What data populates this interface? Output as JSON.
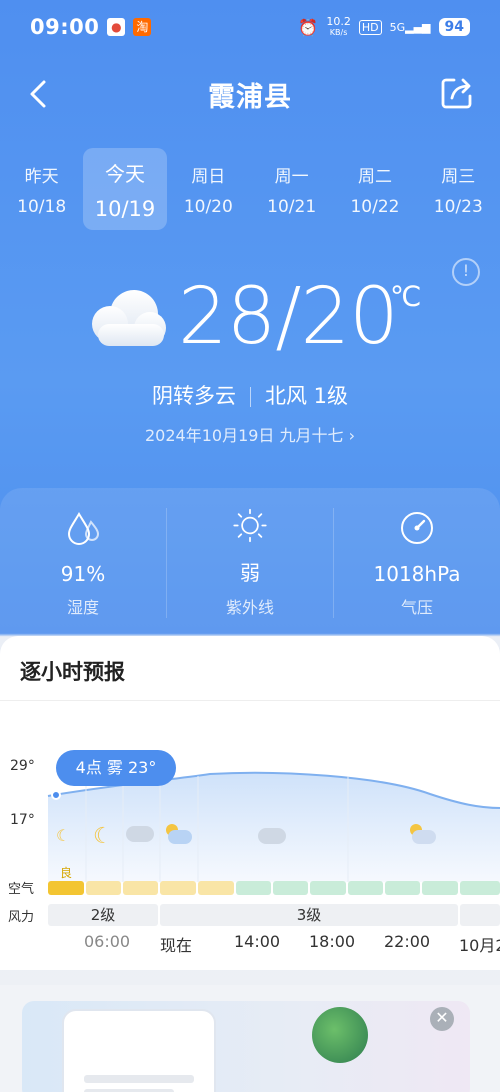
{
  "status_bar": {
    "time": "09:00",
    "net_speed": "10.2",
    "net_unit": "KB/s",
    "hd": "HD",
    "signal": "5G",
    "battery": "94"
  },
  "header": {
    "title": "霞浦县"
  },
  "days": [
    {
      "name": "昨天",
      "date": "10/18"
    },
    {
      "name": "今天",
      "date": "10/19"
    },
    {
      "name": "周日",
      "date": "10/20"
    },
    {
      "name": "周一",
      "date": "10/21"
    },
    {
      "name": "周二",
      "date": "10/22"
    },
    {
      "name": "周三",
      "date": "10/23"
    }
  ],
  "current": {
    "temp": "28/20",
    "unit": "℃",
    "condition": "阴转多云",
    "wind": "北风 1级",
    "date_line": "2024年10月19日 九月十七"
  },
  "stats": [
    {
      "value": "91%",
      "label": "湿度",
      "icon": "humidity-icon"
    },
    {
      "value": "弱",
      "label": "紫外线",
      "icon": "sun-icon"
    },
    {
      "value": "1018hPa",
      "label": "气压",
      "icon": "pressure-icon"
    }
  ],
  "hourly": {
    "title": "逐小时预报",
    "y_high": "29°",
    "y_low": "17°",
    "tooltip": "4点 雾 23°",
    "aqi_label": "空气",
    "aqi_good": "良",
    "wind_label": "风力",
    "wind_segments": [
      "2级",
      "3级"
    ],
    "times": [
      "06:00",
      "现在",
      "14:00",
      "18:00",
      "22:00",
      "10月2"
    ]
  },
  "colors": {
    "accent": "#4d8eee",
    "aqi_good": "#f6d56b",
    "aqi_excellent": "#c9ecd9"
  }
}
